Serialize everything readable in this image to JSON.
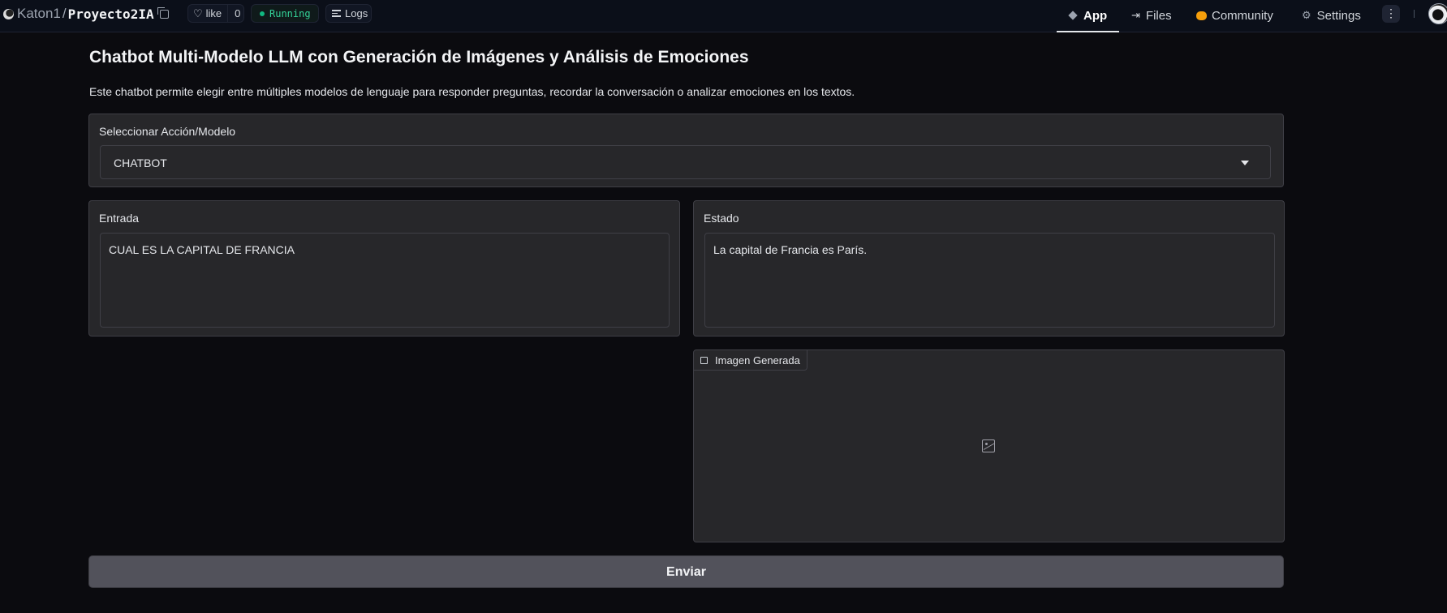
{
  "header": {
    "owner": "Katon1",
    "separator": "/",
    "space_name": "Proyecto2IA",
    "like_label": "like",
    "like_count": "0",
    "status": "Running",
    "logs_label": "Logs",
    "tabs": [
      {
        "label": "App",
        "icon": "cube-icon",
        "active": true
      },
      {
        "label": "Files",
        "icon": "files-icon"
      },
      {
        "label": "Community",
        "icon": "community-icon"
      },
      {
        "label": "Settings",
        "icon": "gear-icon"
      }
    ],
    "more_icon": "⋮"
  },
  "main": {
    "title": "Chatbot Multi-Modelo LLM con Generación de Imágenes y Análisis de Emociones",
    "description": "Este chatbot permite elegir entre múltiples modelos de lenguaje para responder preguntas, recordar la conversación o analizar emociones en los textos.",
    "select": {
      "label": "Seleccionar Acción/Modelo",
      "value": "CHATBOT"
    },
    "input": {
      "label": "Entrada",
      "value": "CUAL ES LA CAPITAL DE FRANCIA"
    },
    "output": {
      "label": "Estado",
      "value": "La capital de Francia es París."
    },
    "image": {
      "label": "Imagen Generada"
    },
    "submit_label": "Enviar"
  },
  "colors": {
    "background": "#0b0b0f",
    "panel": "#27272a",
    "border": "#3f3f46",
    "button": "#52525b",
    "running": "#34d399"
  }
}
